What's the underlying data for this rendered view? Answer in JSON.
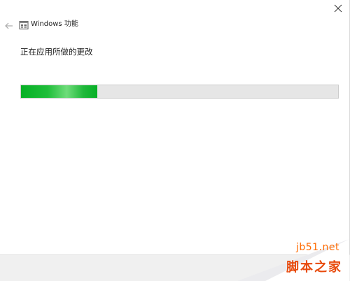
{
  "window": {
    "title": "Windows 功能"
  },
  "main": {
    "status_text": "正在应用所做的更改"
  },
  "progress": {
    "value": 0.24,
    "fill_color": "#06b025",
    "track_color": "#e6e6e6"
  },
  "icons": {
    "back": "arrow-left-icon",
    "app": "windows-features-icon",
    "close": "close-icon"
  },
  "watermark": {
    "site": "jb51.net",
    "name": "脚本之家"
  }
}
